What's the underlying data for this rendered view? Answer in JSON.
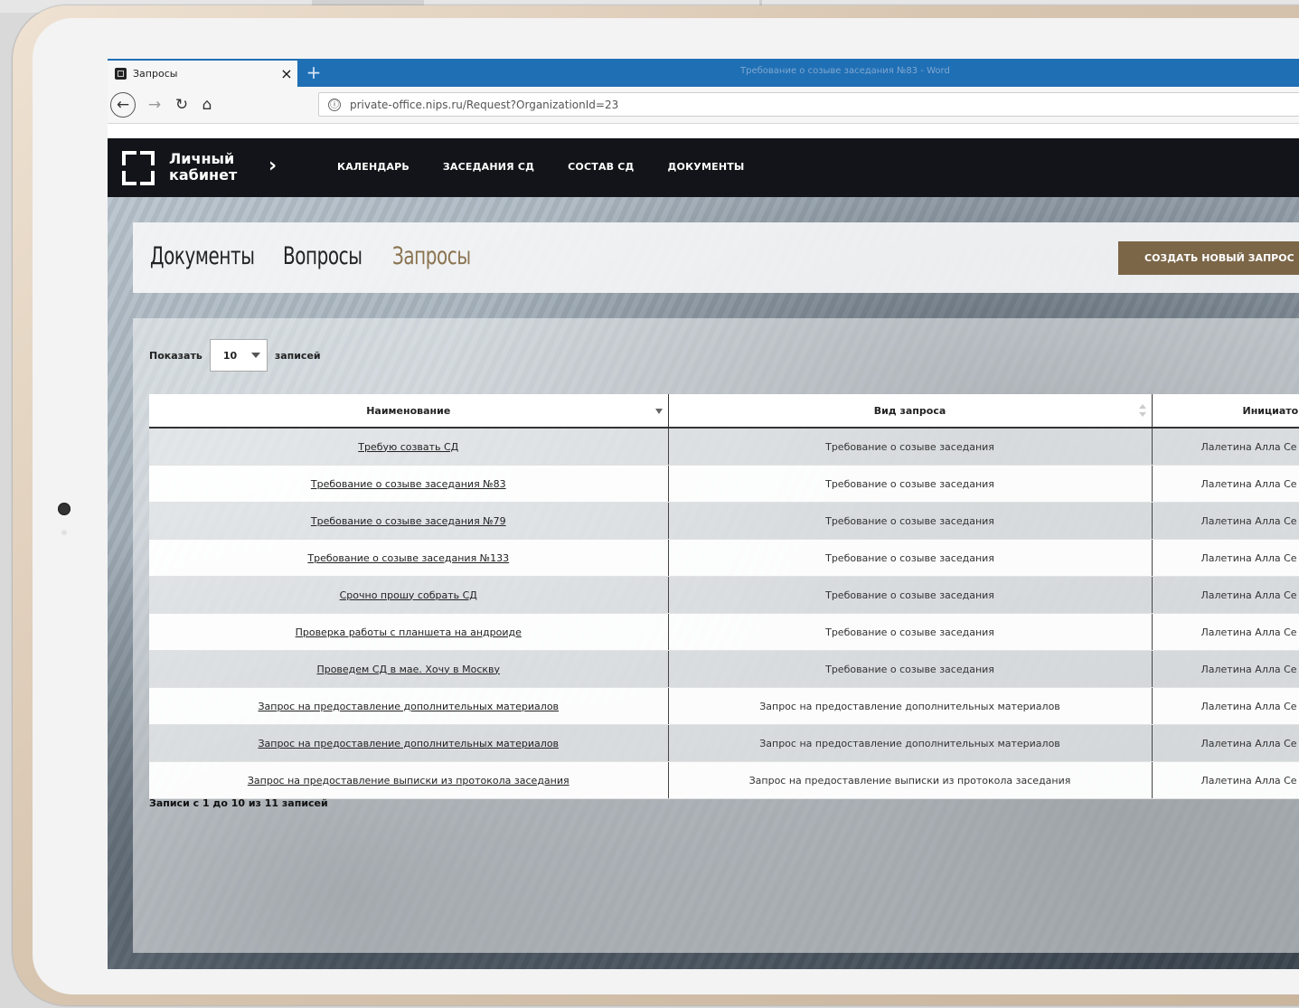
{
  "browser": {
    "tab_title": "Запросы",
    "tab_close": "×",
    "new_tab": "+",
    "window_title": "Требование о созыве заседания №83 - Word",
    "url": "private-office.nips.ru/Request?OrganizationId=23",
    "url_info_icon": "ⓘ"
  },
  "header": {
    "logo_text": "Личный кабинет",
    "nav": [
      "КАЛЕНДАРЬ",
      "ЗАСЕДАНИЯ СД",
      "СОСТАВ СД",
      "ДОКУМЕНТЫ"
    ]
  },
  "page": {
    "tabs": [
      "Документы",
      "Вопросы",
      "Запросы"
    ],
    "active_tab": "Запросы",
    "create_button": "СОЗДАТЬ НОВЫЙ ЗАПРОС",
    "show_label": "Показать",
    "page_size": "10",
    "records_label": "записей",
    "records_info": "Записи с 1 до 10 из 11 записей"
  },
  "table": {
    "columns": [
      "Наименование",
      "Вид запроса",
      "Инициатор"
    ],
    "rows": [
      [
        "Требую созвать СД",
        "Требование о созыве заседания",
        "Лалетина Алла Се"
      ],
      [
        "Требование о созыве заседания №83",
        "Требование о созыве заседания",
        "Лалетина Алла Се"
      ],
      [
        "Требование о созыве заседания №79",
        "Требование о созыве заседания",
        "Лалетина Алла Се"
      ],
      [
        "Требование о созыве заседания №133",
        "Требование о созыве заседания",
        "Лалетина Алла Се"
      ],
      [
        "Срочно прошу собрать СД",
        "Требование о созыве заседания",
        "Лалетина Алла Се"
      ],
      [
        "Проверка работы с планшета на андроиде",
        "Требование о созыве заседания",
        "Лалетина Алла Се"
      ],
      [
        "Проведем СД в мае. Хочу в Москву",
        "Требование о созыве заседания",
        "Лалетина Алла Се"
      ],
      [
        "Запрос на предоставление дополнительных материалов",
        "Запрос на предоставление дополнительных материалов",
        "Лалетина Алла Се"
      ],
      [
        "Запрос на предоставление дополнительных материалов",
        "Запрос на предоставление дополнительных материалов",
        "Лалетина Алла Се"
      ],
      [
        "Запрос на предоставление выписки из протокола заседания",
        "Запрос на предоставление выписки из протокола заседания",
        "Лалетина Алла Се"
      ]
    ]
  },
  "colors": {
    "accent": "#7b6648",
    "active_tab": "#8a7350",
    "header_bg": "#131419",
    "tabstrip": "#1f6fb5"
  }
}
